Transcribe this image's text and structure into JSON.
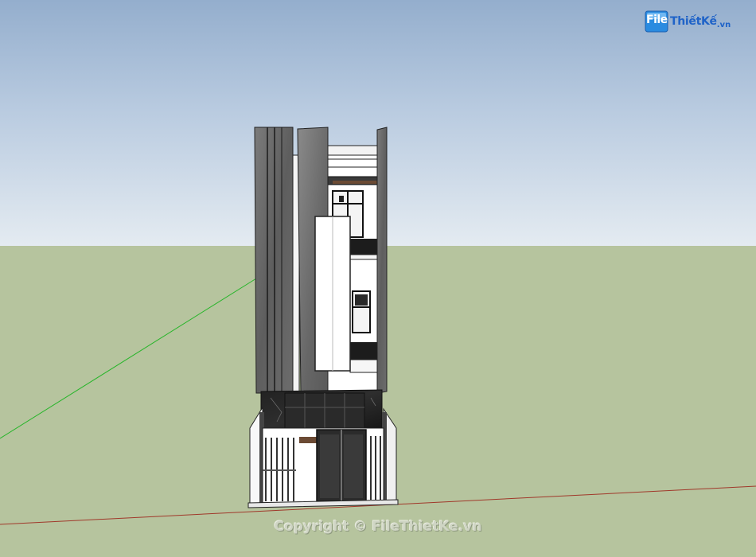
{
  "watermark": {
    "logo_file": "File",
    "logo_name": "ThiếtKế",
    "logo_tld": ".vn"
  },
  "footer": {
    "copyright": "Copyright © FileThietKe.vn"
  },
  "colors": {
    "sky_top": "#94aecd",
    "sky_bottom": "#e4ebf1",
    "ground": "#b6c49e",
    "concrete": "#6f6f6f",
    "marble": "#1c1c1c",
    "white_wall": "#ffffff",
    "logo_blue": "#1f63c8"
  }
}
